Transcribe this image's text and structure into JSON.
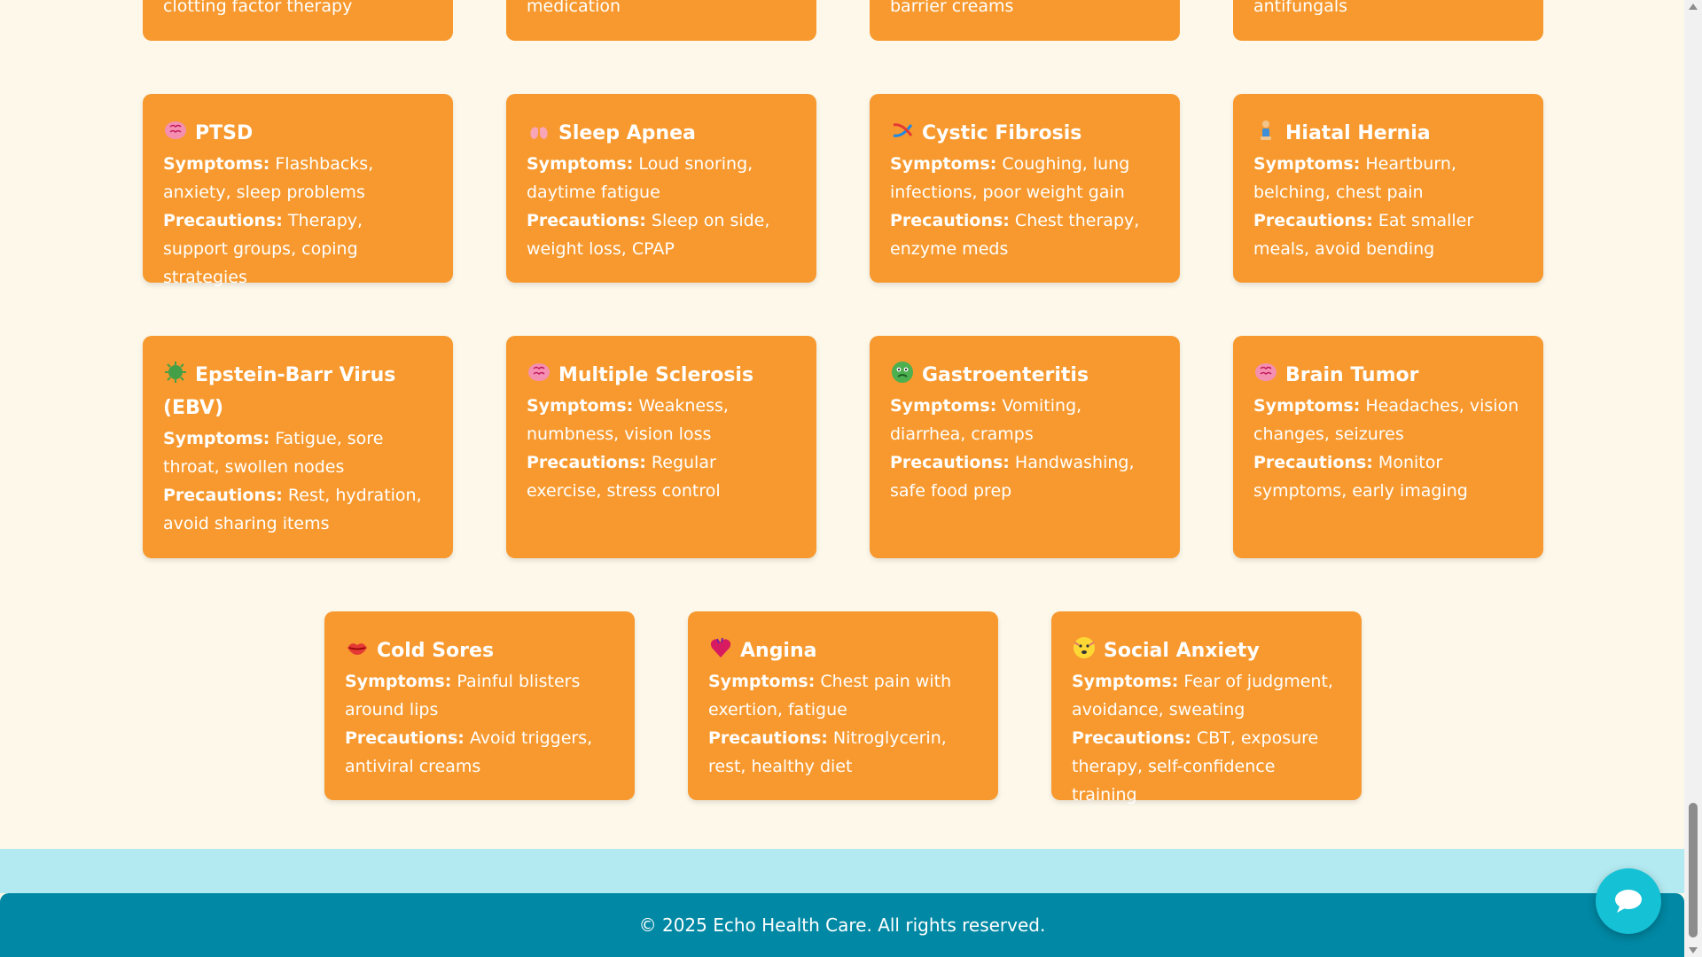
{
  "top_row": [
    {
      "text": "clotting factor therapy"
    },
    {
      "text": "medication"
    },
    {
      "text": "barrier creams"
    },
    {
      "text": "antifungals"
    }
  ],
  "labels": {
    "symptoms": "Symptoms:",
    "precautions": "Precautions:"
  },
  "cards": [
    {
      "icon": "brain-icon",
      "title": "PTSD",
      "symptoms": "Flashbacks, anxiety, sleep problems",
      "precautions": "Therapy, support groups, coping strategies"
    },
    {
      "icon": "lungs-icon",
      "title": "Sleep Apnea",
      "symptoms": "Loud snoring, daytime fatigue",
      "precautions": "Sleep on side, weight loss, CPAP"
    },
    {
      "icon": "dna-icon",
      "title": "Cystic Fibrosis",
      "symptoms": "Coughing, lung infections, poor weight gain",
      "precautions": "Chest therapy, enzyme meds"
    },
    {
      "icon": "person-icon",
      "title": "Hiatal Hernia",
      "symptoms": "Heartburn, belching, chest pain",
      "precautions": "Eat smaller meals, avoid bending"
    },
    {
      "icon": "microbe-icon",
      "title": "Epstein-Barr Virus (EBV)",
      "symptoms": "Fatigue, sore throat, swollen nodes",
      "precautions": "Rest, hydration, avoid sharing items"
    },
    {
      "icon": "brain-icon",
      "title": "Multiple Sclerosis",
      "symptoms": "Weakness, numbness, vision loss",
      "precautions": "Regular exercise, stress control"
    },
    {
      "icon": "nauseated-face-icon",
      "title": "Gastroenteritis",
      "symptoms": "Vomiting, diarrhea, cramps",
      "precautions": "Handwashing, safe food prep"
    },
    {
      "icon": "brain-icon",
      "title": "Brain Tumor",
      "symptoms": "Headaches, vision changes, seizures",
      "precautions": "Monitor symptoms, early imaging"
    },
    {
      "icon": "lips-icon",
      "title": "Cold Sores",
      "symptoms": "Painful blisters around lips",
      "precautions": "Avoid triggers, antiviral creams"
    },
    {
      "icon": "heart-icon",
      "title": "Angina",
      "symptoms": "Chest pain with exertion, fatigue",
      "precautions": "Nitroglycerin, rest, healthy diet"
    },
    {
      "icon": "anxious-face-icon",
      "title": "Social Anxiety",
      "symptoms": "Fear of judgment, avoidance, sweating",
      "precautions": "CBT, exposure therapy, self-confidence training"
    }
  ],
  "footer": {
    "text": "© 2025 Echo Health Care. All rights reserved."
  },
  "chat": {
    "icon": "chat-bubble-icon"
  },
  "colors": {
    "card": "#f7992e",
    "background": "#fdf8ea",
    "footer": "#0088a4",
    "band": "#b3eaf1",
    "chat_button": "#15c1d5"
  }
}
